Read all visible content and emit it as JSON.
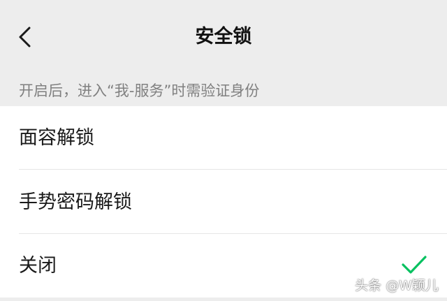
{
  "header": {
    "title": "安全锁",
    "back_icon": "chevron-left-icon"
  },
  "hint": "开启后，进入“我-服务”时需验证身份",
  "options": [
    {
      "label": "面容解锁",
      "selected": false
    },
    {
      "label": "手势密码解锁",
      "selected": false
    },
    {
      "label": "关闭",
      "selected": true
    }
  ],
  "check_icon": "checkmark-icon",
  "colors": {
    "background": "#ededed",
    "surface": "#ffffff",
    "accent": "#07c160",
    "hint_text": "#808080"
  },
  "watermark": "头条 @W颖儿"
}
